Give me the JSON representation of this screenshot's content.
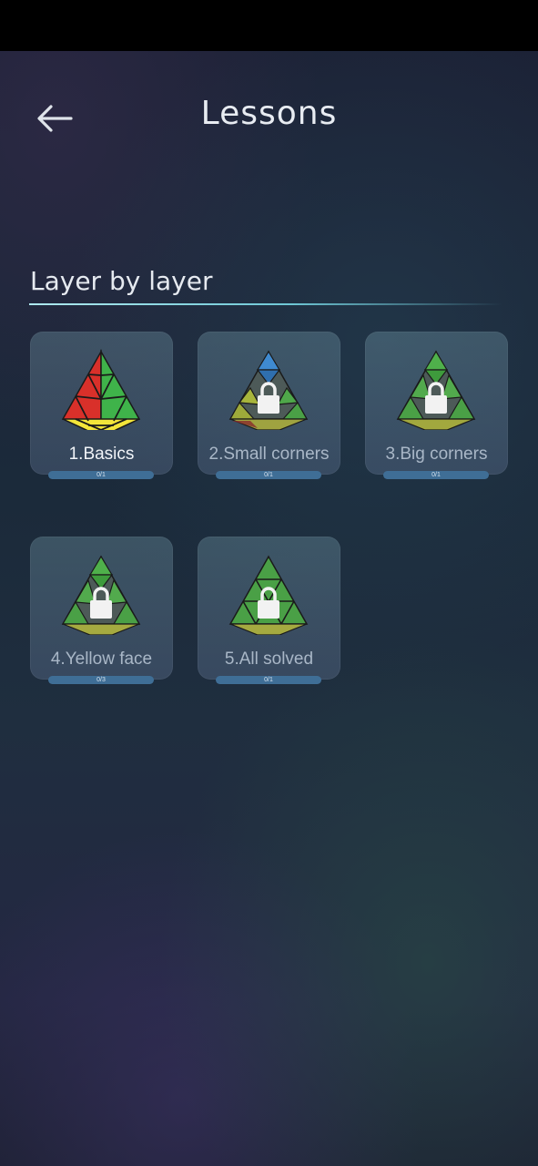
{
  "header": {
    "title": "Lessons"
  },
  "section": {
    "title": "Layer by layer"
  },
  "lessons": [
    {
      "label": "1.Basics",
      "progress_text": "0/1",
      "progress": 0,
      "locked": false
    },
    {
      "label": "2.Small corners",
      "progress_text": "0/1",
      "progress": 0,
      "locked": true
    },
    {
      "label": "3.Big corners",
      "progress_text": "0/1",
      "progress": 0,
      "locked": true
    },
    {
      "label": "4.Yellow face",
      "progress_text": "0/3",
      "progress": 0,
      "locked": true
    },
    {
      "label": "5.All solved",
      "progress_text": "0/1",
      "progress": 0,
      "locked": true
    }
  ],
  "colors": {
    "accent": "#6fc8d6",
    "progress_track": "#3f6e96",
    "pyraminx_red": "#d9302a",
    "pyraminx_green": "#3fb34a",
    "pyraminx_yellow": "#f3e53a",
    "pyraminx_blue": "#2e7fd0"
  }
}
